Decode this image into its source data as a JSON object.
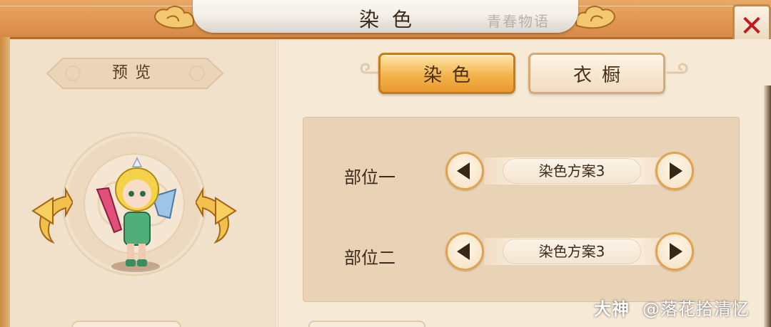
{
  "window": {
    "title": "染色",
    "title_script": "青春物语"
  },
  "close": {
    "label": "✕"
  },
  "preview": {
    "label": "预览"
  },
  "tabs": [
    {
      "label": "染色",
      "active": true
    },
    {
      "label": "衣橱",
      "active": false
    }
  ],
  "parts": [
    {
      "label": "部位一",
      "value": "染色方案3"
    },
    {
      "label": "部位二",
      "value": "染色方案3"
    }
  ],
  "watermark": {
    "brand": "大神",
    "handle": "@落花拾清忆"
  },
  "colors": {
    "frame": "#d88a45",
    "active_tab": "#f3b44c",
    "close_x": "#c4161c",
    "panel_bg": "#f3e4cf"
  },
  "icons": [
    "rotate-left-icon",
    "rotate-right-icon",
    "arrow-left-icon",
    "arrow-right-icon",
    "close-icon"
  ]
}
